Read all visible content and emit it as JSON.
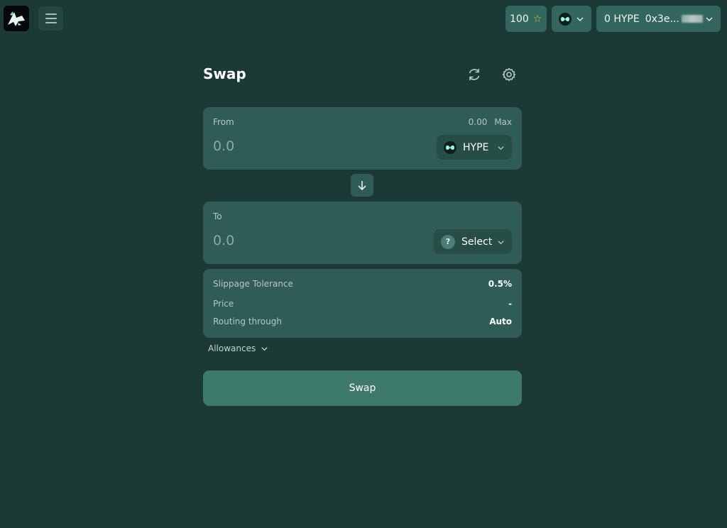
{
  "header": {
    "points": "100",
    "account_balance": "0 HYPE",
    "account_address": "0x3e...",
    "icons": {
      "menu": "hamburger-icon",
      "points": "star-icon",
      "network": "hype-logo-icon",
      "dropdown": "chevron-down-icon"
    }
  },
  "swap": {
    "title": "Swap",
    "from": {
      "label": "From",
      "balance": "0.00",
      "max_label": "Max",
      "amount_placeholder": "0.0",
      "token": "HYPE"
    },
    "to": {
      "label": "To",
      "amount_placeholder": "0.0",
      "token_placeholder": "Select",
      "token_icon_text": "?"
    },
    "details": {
      "rows": [
        {
          "label": "Slippage Tolerance",
          "value": "0.5%"
        },
        {
          "label": "Price",
          "value": "-"
        },
        {
          "label": "Routing through",
          "value": "Auto"
        }
      ]
    },
    "allowances_label": "Allowances",
    "submit_label": "Swap"
  },
  "colors": {
    "background": "#1c3a35",
    "card": "#2f5c55",
    "accent_button": "#3e7a6c",
    "header_pill": "#33665d",
    "star": "#e2c33a"
  }
}
